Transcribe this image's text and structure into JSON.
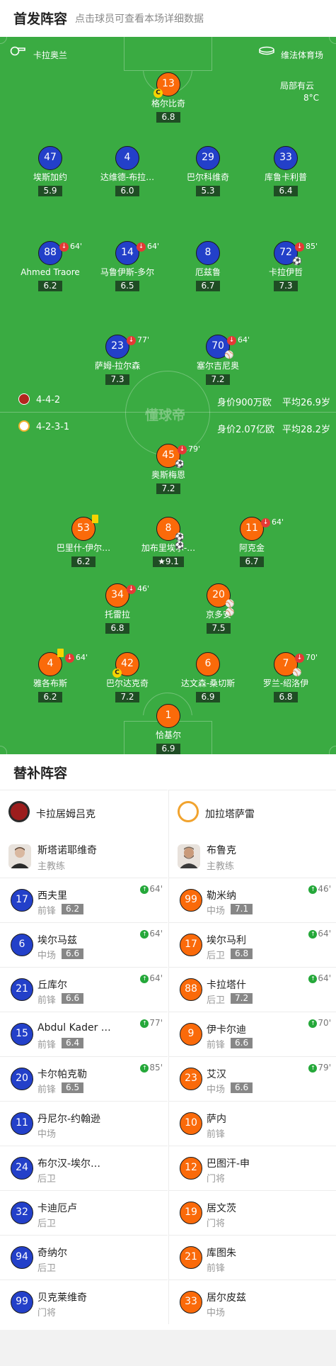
{
  "header": {
    "title": "首发阵容",
    "subtitle": "点击球员可查看本场详细数据"
  },
  "pitch": {
    "home_team": "卡拉奥兰",
    "venue": "维法体育场",
    "weather": "局部有云",
    "temperature": "8°C",
    "watermark": "懂球帝",
    "home_formation": "4-4-2",
    "home_value": "身价900万欧",
    "home_age": "平均26.9岁",
    "away_formation": "4-2-3-1",
    "away_value": "身价2.07亿欧",
    "away_age": "平均28.2岁"
  },
  "home_players": [
    {
      "num": "13",
      "name": "格尔比奇",
      "rating": "6.8"
    },
    {
      "num": "47",
      "name": "埃斯加约",
      "rating": "5.9"
    },
    {
      "num": "4",
      "name": "达维德-布拉…",
      "rating": "6.0"
    },
    {
      "num": "29",
      "name": "巴尔科维奇",
      "rating": "5.3"
    },
    {
      "num": "33",
      "name": "库鲁卡利普",
      "rating": "6.4"
    },
    {
      "num": "88",
      "name": "Ahmed Traore",
      "rating": "6.2",
      "sub": "64'"
    },
    {
      "num": "14",
      "name": "马鲁伊斯-多尔",
      "rating": "6.5",
      "sub": "64'"
    },
    {
      "num": "8",
      "name": "厄兹鲁",
      "rating": "6.7"
    },
    {
      "num": "72",
      "name": "卡拉伊哲",
      "rating": "7.3",
      "sub": "85'"
    },
    {
      "num": "23",
      "name": "萨姆-拉尔森",
      "rating": "7.3",
      "sub": "77'"
    },
    {
      "num": "70",
      "name": "塞尔吉尼奥",
      "rating": "7.2",
      "sub": "64'"
    }
  ],
  "away_players": [
    {
      "num": "45",
      "name": "奥斯梅恩",
      "rating": "7.2",
      "sub": "79'"
    },
    {
      "num": "53",
      "name": "巴里什-伊尔…",
      "rating": "6.2"
    },
    {
      "num": "8",
      "name": "加布里埃尔-…",
      "rating": "9.1"
    },
    {
      "num": "11",
      "name": "阿克金",
      "rating": "6.7",
      "sub": "64'"
    },
    {
      "num": "34",
      "name": "托雷拉",
      "rating": "6.8",
      "sub": "46'"
    },
    {
      "num": "20",
      "name": "京多安",
      "rating": "7.5"
    },
    {
      "num": "4",
      "name": "雅各布斯",
      "rating": "6.2",
      "sub": "64'"
    },
    {
      "num": "42",
      "name": "巴尔达克奇",
      "rating": "7.2"
    },
    {
      "num": "6",
      "name": "达文森-桑切斯",
      "rating": "6.9"
    },
    {
      "num": "7",
      "name": "罗兰-绍洛伊",
      "rating": "6.8",
      "sub": "70'"
    },
    {
      "num": "1",
      "name": "恰基尔",
      "rating": "6.9"
    }
  ],
  "subs": {
    "title": "替补阵容",
    "home": {
      "team": "卡拉居姆吕克",
      "coach_name": "斯塔诺耶维奇",
      "coach_role": "主教练",
      "players": [
        {
          "num": "17",
          "name": "西夫里",
          "pos": "前锋",
          "rating": "6.2",
          "min": "64'"
        },
        {
          "num": "6",
          "name": "埃尔马兹",
          "pos": "中场",
          "rating": "6.6",
          "min": "64'"
        },
        {
          "num": "21",
          "name": "丘库尔",
          "pos": "前锋",
          "rating": "6.6",
          "min": "64'"
        },
        {
          "num": "15",
          "name": "Abdul Kader …",
          "pos": "前锋",
          "rating": "6.4",
          "min": "77'"
        },
        {
          "num": "20",
          "name": "卡尔帕克勒",
          "pos": "前锋",
          "rating": "6.5",
          "min": "85'"
        },
        {
          "num": "11",
          "name": "丹尼尔-约翰逊",
          "pos": "中场"
        },
        {
          "num": "24",
          "name": "布尔汉-埃尔…",
          "pos": "后卫"
        },
        {
          "num": "32",
          "name": "卡迪厄卢",
          "pos": "后卫"
        },
        {
          "num": "94",
          "name": "奇纳尔",
          "pos": "后卫"
        },
        {
          "num": "99",
          "name": "贝克莱维奇",
          "pos": "门将"
        }
      ]
    },
    "away": {
      "team": "加拉塔萨雷",
      "coach_name": "布鲁克",
      "coach_role": "主教练",
      "players": [
        {
          "num": "99",
          "name": "勒米纳",
          "pos": "中场",
          "rating": "7.1",
          "min": "46'"
        },
        {
          "num": "17",
          "name": "埃尔马利",
          "pos": "后卫",
          "rating": "6.8",
          "min": "64'"
        },
        {
          "num": "88",
          "name": "卡拉塔什",
          "pos": "后卫",
          "rating": "7.2",
          "min": "64'"
        },
        {
          "num": "9",
          "name": "伊卡尔迪",
          "pos": "前锋",
          "rating": "6.6",
          "min": "70'"
        },
        {
          "num": "23",
          "name": "艾汉",
          "pos": "中场",
          "rating": "6.6",
          "min": "79'"
        },
        {
          "num": "10",
          "name": "萨内",
          "pos": "前锋"
        },
        {
          "num": "12",
          "name": "巴图汗-申",
          "pos": "门将"
        },
        {
          "num": "19",
          "name": "居文茨",
          "pos": "门将"
        },
        {
          "num": "21",
          "name": "库图朱",
          "pos": "前锋"
        },
        {
          "num": "33",
          "name": "居尔皮兹",
          "pos": "中场"
        }
      ]
    }
  },
  "colors": {
    "pitch": "#3aab42",
    "home": "#2340c9",
    "away": "#fa6a0a",
    "rating_bg": "#1f4d24"
  }
}
